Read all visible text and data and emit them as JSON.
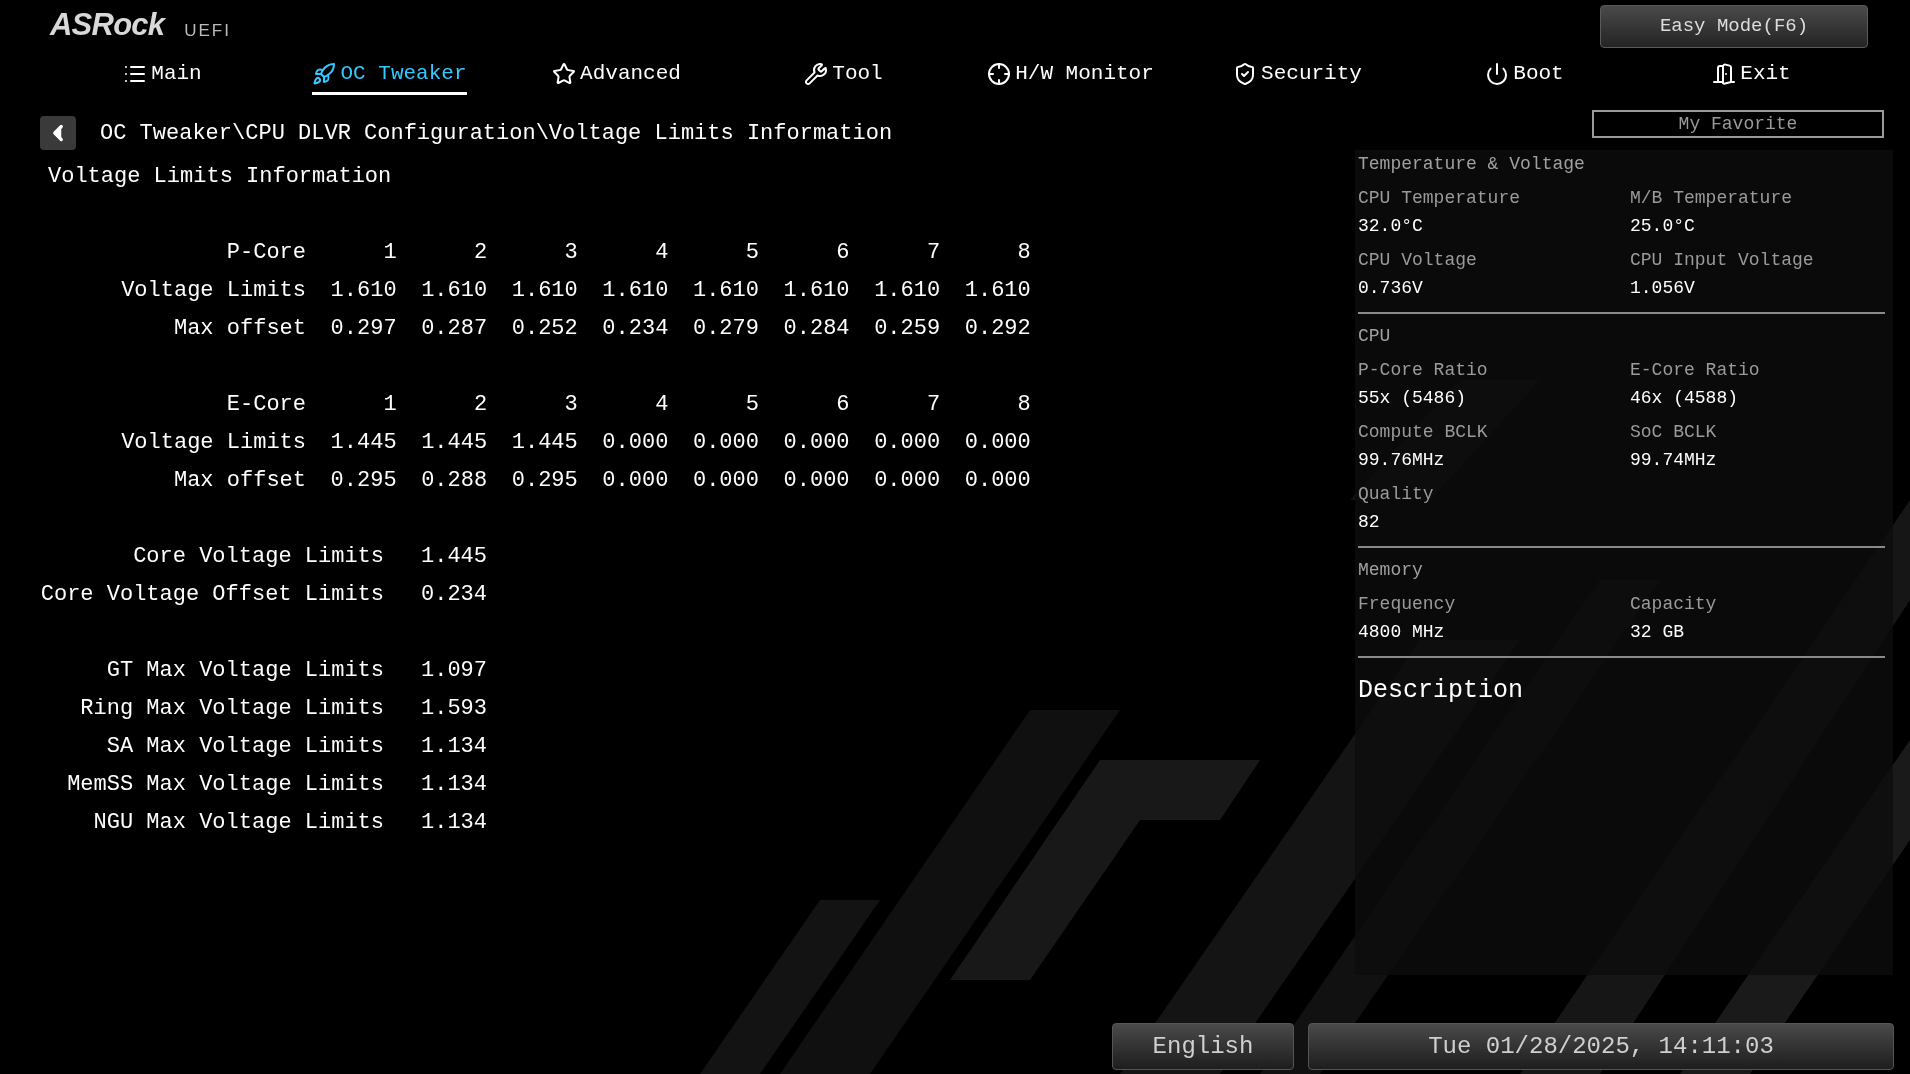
{
  "header": {
    "logo": "ASRock",
    "logo_suffix": "UEFI",
    "easy_mode_button": "Easy Mode(F6)",
    "my_favorite_button": "My Favorite"
  },
  "tabs": [
    {
      "label": "Main",
      "selected": false
    },
    {
      "label": "OC Tweaker",
      "selected": true
    },
    {
      "label": "Advanced",
      "selected": false
    },
    {
      "label": "Tool",
      "selected": false
    },
    {
      "label": "H/W Monitor",
      "selected": false
    },
    {
      "label": "Security",
      "selected": false
    },
    {
      "label": "Boot",
      "selected": false
    },
    {
      "label": "Exit",
      "selected": false
    }
  ],
  "breadcrumb": "OC Tweaker\\CPU DLVR Configuration\\Voltage Limits Information",
  "page_title": "Voltage Limits Information",
  "core_tables": [
    {
      "header": "P-Core",
      "columns": [
        "1",
        "2",
        "3",
        "4",
        "5",
        "6",
        "7",
        "8"
      ],
      "rows": [
        {
          "label": "Voltage Limits",
          "values": [
            "1.610",
            "1.610",
            "1.610",
            "1.610",
            "1.610",
            "1.610",
            "1.610",
            "1.610"
          ]
        },
        {
          "label": "Max offset",
          "values": [
            "0.297",
            "0.287",
            "0.252",
            "0.234",
            "0.279",
            "0.284",
            "0.259",
            "0.292"
          ]
        }
      ]
    },
    {
      "header": "E-Core",
      "columns": [
        "1",
        "2",
        "3",
        "4",
        "5",
        "6",
        "7",
        "8"
      ],
      "rows": [
        {
          "label": "Voltage Limits",
          "values": [
            "1.445",
            "1.445",
            "1.445",
            "0.000",
            "0.000",
            "0.000",
            "0.000",
            "0.000"
          ]
        },
        {
          "label": "Max offset",
          "values": [
            "0.295",
            "0.288",
            "0.295",
            "0.000",
            "0.000",
            "0.000",
            "0.000",
            "0.000"
          ]
        }
      ]
    }
  ],
  "limit_groups": [
    [
      {
        "label": "Core Voltage Limits",
        "value": "1.445"
      },
      {
        "label": "Core Voltage Offset Limits",
        "value": "0.234"
      }
    ],
    [
      {
        "label": "GT Max Voltage Limits",
        "value": "1.097"
      },
      {
        "label": "Ring Max Voltage Limits",
        "value": "1.593"
      },
      {
        "label": "SA Max Voltage Limits",
        "value": "1.134"
      },
      {
        "label": "MemSS Max Voltage Limits",
        "value": "1.134"
      },
      {
        "label": "NGU Max Voltage Limits",
        "value": "1.134"
      }
    ]
  ],
  "info_panel": {
    "sections": [
      {
        "title": "Temperature & Voltage",
        "items": [
          {
            "label": "CPU Temperature",
            "value": "32.0°C"
          },
          {
            "label": "M/B Temperature",
            "value": "25.0°C"
          },
          {
            "label": "CPU Voltage",
            "value": "0.736V"
          },
          {
            "label": "CPU Input Voltage",
            "value": "1.056V"
          }
        ]
      },
      {
        "title": "CPU",
        "items": [
          {
            "label": "P-Core Ratio",
            "value": "55x (5486)"
          },
          {
            "label": "E-Core Ratio",
            "value": "46x (4588)"
          },
          {
            "label": "Compute BCLK",
            "value": "99.76MHz"
          },
          {
            "label": "SoC BCLK",
            "value": "99.74MHz"
          },
          {
            "label": "Quality",
            "value": "82"
          }
        ]
      },
      {
        "title": "Memory",
        "items": [
          {
            "label": "Frequency",
            "value": "4800 MHz"
          },
          {
            "label": "Capacity",
            "value": "32 GB"
          }
        ]
      }
    ],
    "description_title": "Description"
  },
  "footer": {
    "language": "English",
    "datetime": "Tue 01/28/2025, 14:11:03"
  }
}
